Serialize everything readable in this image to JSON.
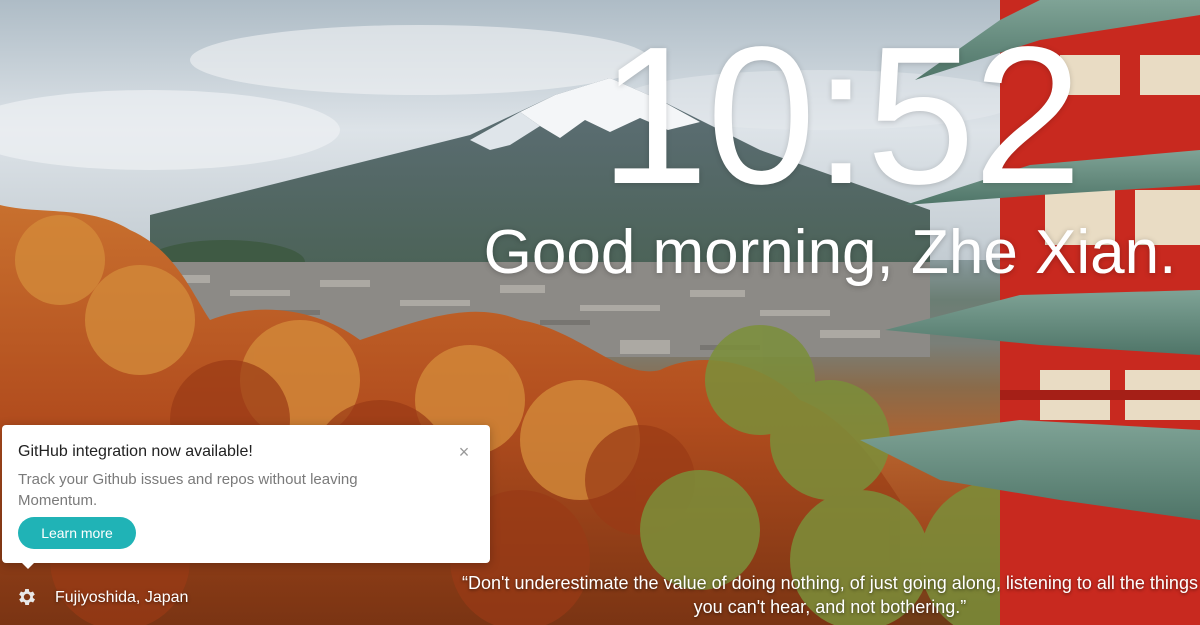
{
  "clock": {
    "time": "10:52"
  },
  "greeting": {
    "text": "Good morning, Zhe Xian."
  },
  "popup": {
    "title": "GitHub integration now available!",
    "body": "Track your Github issues and repos without leaving Momentum.",
    "button_label": "Learn more",
    "close_glyph": "×",
    "button_color": "#20b3b6"
  },
  "footer": {
    "location": "Fujiyoshida, Japan",
    "settings_icon": "gear-icon",
    "quote": "“Don't underestimate the value of doing nothing, of just going along, listening to all the things you can't hear, and not bothering.”"
  },
  "background": {
    "scene": "mount-fuji-pagoda-autumn"
  }
}
